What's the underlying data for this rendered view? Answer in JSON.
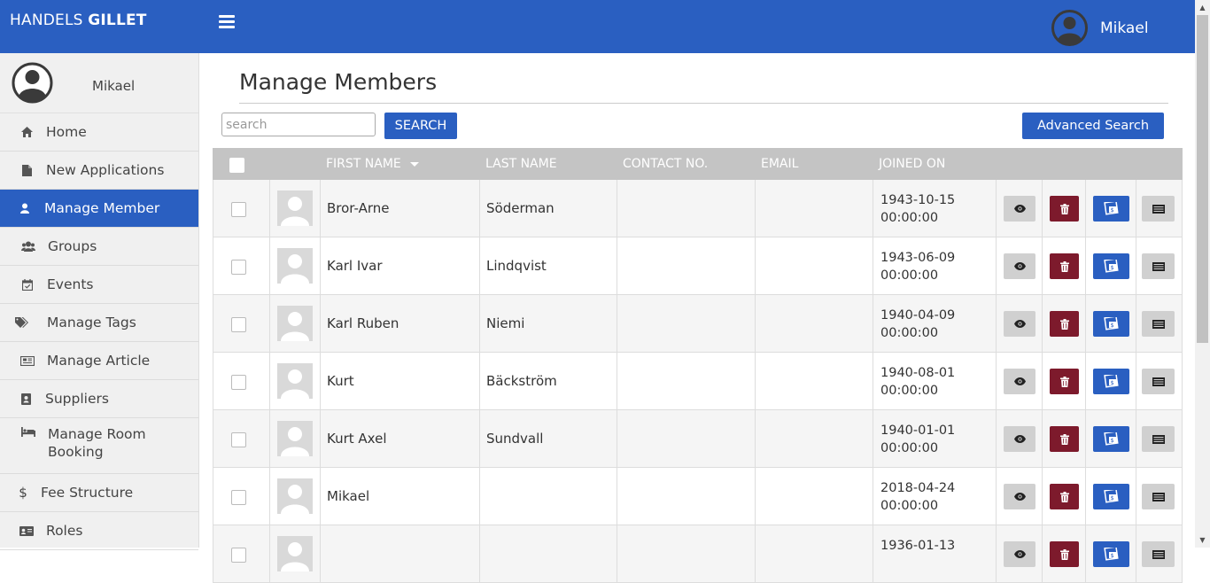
{
  "header": {
    "brand_light": "HANDELS ",
    "brand_bold": "GILLET",
    "user_name": "Mikael"
  },
  "sidebar": {
    "user_name": "Mikael",
    "items": [
      {
        "label": "Home",
        "icon": "home-icon"
      },
      {
        "label": "New Applications",
        "icon": "document-icon"
      },
      {
        "label": "Manage Member",
        "icon": "user-icon"
      },
      {
        "label": "Groups",
        "icon": "users-icon"
      },
      {
        "label": "Events",
        "icon": "calendar-icon"
      },
      {
        "label": "Manage Tags",
        "icon": "tags-icon"
      },
      {
        "label": "Manage Article",
        "icon": "newspaper-icon"
      },
      {
        "label": "Suppliers",
        "icon": "address-book-icon"
      },
      {
        "label": "Manage Room Booking",
        "icon": "bed-icon"
      },
      {
        "label": "Fee Structure",
        "icon": "dollar-icon"
      },
      {
        "label": "Roles",
        "icon": "id-card-icon"
      }
    ],
    "active_index": 2
  },
  "main": {
    "title": "Manage Members",
    "search_placeholder": "search",
    "search_button": "SEARCH",
    "advanced_search_button": "Advanced Search"
  },
  "table": {
    "columns": [
      "FIRST NAME",
      "LAST NAME",
      "CONTACT NO.",
      "EMAIL",
      "JOINED ON"
    ],
    "rows": [
      {
        "first": "Bror-Arne",
        "last": "Söderman",
        "contact": "",
        "email": "",
        "joined_date": "1943-10-15",
        "joined_time": "00:00:00"
      },
      {
        "first": "Karl Ivar",
        "last": "Lindqvist",
        "contact": "",
        "email": "",
        "joined_date": "1943-06-09",
        "joined_time": "00:00:00"
      },
      {
        "first": "Karl Ruben",
        "last": "Niemi",
        "contact": "",
        "email": "",
        "joined_date": "1940-04-09",
        "joined_time": "00:00:00"
      },
      {
        "first": "Kurt",
        "last": "Bäckström",
        "contact": "",
        "email": "",
        "joined_date": "1940-08-01",
        "joined_time": "00:00:00"
      },
      {
        "first": "Kurt Axel",
        "last": "Sundvall",
        "contact": "",
        "email": "",
        "joined_date": "1940-01-01",
        "joined_time": "00:00:00"
      },
      {
        "first": "Mikael",
        "last": "",
        "contact": "",
        "email": "",
        "joined_date": "2018-04-24",
        "joined_time": "00:00:00"
      },
      {
        "first": "",
        "last": "",
        "contact": "",
        "email": "",
        "joined_date": "1936-01-13",
        "joined_time": ""
      }
    ]
  },
  "colors": {
    "primary": "#2a5fc1",
    "danger": "#7d1a2c",
    "header_gray": "#c4c4c4"
  }
}
